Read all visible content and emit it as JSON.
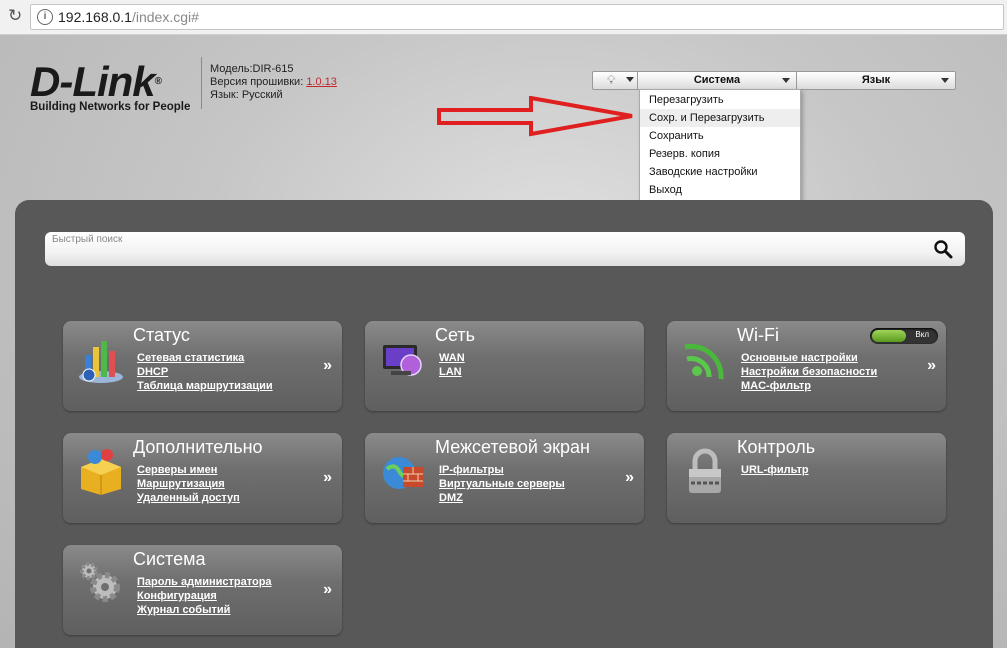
{
  "browser": {
    "url_host": "192.168.0.1",
    "url_path": "/index.cgi#"
  },
  "logo": {
    "brand": "D-Link",
    "tagline": "Building Networks for People"
  },
  "device": {
    "model_label": "Модель:",
    "model_value": "DIR-615",
    "firmware_label": "Версия прошивки:",
    "firmware_value": "1.0.13",
    "language_label": "Язык:",
    "language_value": "Русский"
  },
  "nav": {
    "system_label": "Система",
    "language_label": "Язык"
  },
  "system_menu": {
    "items": [
      "Перезагрузить",
      "Сохр. и Перезагрузить",
      "Сохранить",
      "Резерв. копия",
      "Заводские настройки",
      "Выход"
    ],
    "highlighted_index": 1
  },
  "search": {
    "placeholder": "Быстрый поиск"
  },
  "tiles": [
    {
      "title": "Статус",
      "links": [
        "Сетевая статистика",
        "DHCP",
        "Таблица маршрутизации"
      ],
      "icon": "status-chart-icon"
    },
    {
      "title": "Сеть",
      "links": [
        "WAN",
        "LAN"
      ],
      "icon": "network-monitor-icon"
    },
    {
      "title": "Wi-Fi",
      "links": [
        "Основные настройки",
        "Настройки безопасности",
        "MAC-фильтр"
      ],
      "icon": "wifi-icon",
      "toggle_label": "Вкл",
      "toggle_on": true
    },
    {
      "title": "Дополнительно",
      "links": [
        "Серверы имен",
        "Маршрутизация",
        "Удаленный доступ"
      ],
      "icon": "advanced-box-icon"
    },
    {
      "title": "Межсетевой экран",
      "links": [
        "IP-фильтры",
        "Виртуальные серверы",
        "DMZ"
      ],
      "icon": "firewall-globe-icon"
    },
    {
      "title": "Контроль",
      "links": [
        "URL-фильтр"
      ],
      "icon": "padlock-icon"
    },
    {
      "title": "Система",
      "links": [
        "Пароль администратора",
        "Конфигурация",
        "Журнал событий"
      ],
      "icon": "gears-icon"
    }
  ],
  "tile_arrow": "»",
  "colors": {
    "panel": "#585858",
    "arrow": "#e02020",
    "firmware_link": "#c0282a"
  }
}
